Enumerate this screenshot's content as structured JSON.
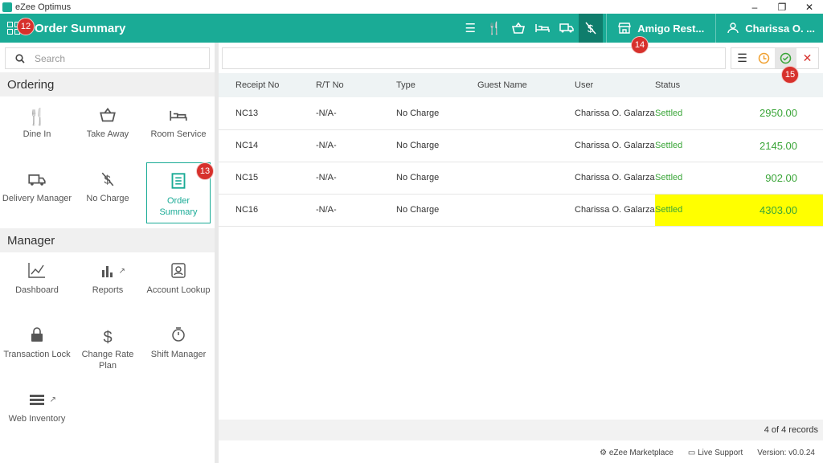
{
  "window": {
    "app_title": "eZee Optimus",
    "min": "–",
    "restore": "❐",
    "close": "✕"
  },
  "topbar": {
    "title": "Order Summary",
    "restaurant": "Amigo Rest...",
    "user": "Charissa O. ..."
  },
  "badges": {
    "b12": "12",
    "b13": "13",
    "b14": "14",
    "b15": "15"
  },
  "sidebar": {
    "search_placeholder": "Search",
    "ordering_header": "Ordering",
    "manager_header": "Manager",
    "ordering": [
      {
        "label": "Dine In",
        "icon": "cutlery-icon"
      },
      {
        "label": "Take Away",
        "icon": "basket-icon"
      },
      {
        "label": "Room Service",
        "icon": "bed-icon"
      },
      {
        "label": "Delivery Manager",
        "icon": "truck-icon"
      },
      {
        "label": "No Charge",
        "icon": "no-charge-icon"
      },
      {
        "label": "Order Summary",
        "icon": "order-summary-icon"
      }
    ],
    "manager": [
      {
        "label": "Dashboard",
        "icon": "chart-icon"
      },
      {
        "label": "Reports",
        "icon": "bar-chart-icon"
      },
      {
        "label": "Account Lookup",
        "icon": "account-icon"
      },
      {
        "label": "Transaction Lock",
        "icon": "lock-icon"
      },
      {
        "label": "Change Rate Plan",
        "icon": "dollar-icon"
      },
      {
        "label": "Shift Manager",
        "icon": "timer-icon"
      },
      {
        "label": "Web Inventory",
        "icon": "inventory-icon"
      }
    ]
  },
  "table": {
    "headers": [
      "Receipt No",
      "R/T No",
      "Type",
      "Guest Name",
      "User",
      "Status"
    ],
    "rows": [
      {
        "receipt": "NC13",
        "rt": "-N/A-",
        "type": "No Charge",
        "guest": "",
        "user": "Charissa O. Galarza",
        "status": "Settled",
        "amount": "2950.00"
      },
      {
        "receipt": "NC14",
        "rt": "-N/A-",
        "type": "No Charge",
        "guest": "",
        "user": "Charissa O. Galarza",
        "status": "Settled",
        "amount": "2145.00"
      },
      {
        "receipt": "NC15",
        "rt": "-N/A-",
        "type": "No Charge",
        "guest": "",
        "user": "Charissa O. Galarza",
        "status": "Settled",
        "amount": "902.00"
      },
      {
        "receipt": "NC16",
        "rt": "-N/A-",
        "type": "No Charge",
        "guest": "",
        "user": "Charissa O. Galarza",
        "status": "Settled",
        "amount": "4303.00"
      }
    ],
    "records": "4 of 4 records"
  },
  "footer": {
    "marketplace": "eZee Marketplace",
    "support": "Live Support",
    "version": "Version: v0.0.24"
  },
  "colors": {
    "brand": "#1aab96",
    "settled": "#3aa538",
    "highlight": "#ffff00",
    "badge": "#d7312c"
  }
}
